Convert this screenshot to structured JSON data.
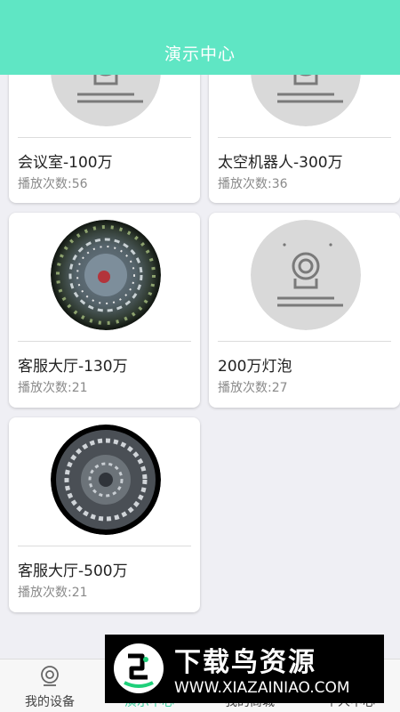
{
  "header": {
    "title": "演示中心"
  },
  "cards": [
    {
      "name": "会议室-100万",
      "plays": "播放次数:56",
      "thumb": "camera-placeholder"
    },
    {
      "name": "太空机器人-300万",
      "plays": "播放次数:36",
      "thumb": "camera-placeholder"
    },
    {
      "name": "客服大厅-130万",
      "plays": "播放次数:21",
      "thumb": "fisheye-photo"
    },
    {
      "name": "200万灯泡",
      "plays": "播放次数:27",
      "thumb": "camera-placeholder"
    },
    {
      "name": "客服大厅-500万",
      "plays": "播放次数:21",
      "thumb": "fisheye-photo"
    }
  ],
  "tabbar": {
    "tabs": [
      {
        "label": "我的设备",
        "icon": "camera-icon"
      },
      {
        "label": "演示中心",
        "icon": "play-icon",
        "active": true
      },
      {
        "label": "我的商城",
        "icon": "store-icon"
      },
      {
        "label": "个人中心",
        "icon": "person-icon"
      }
    ]
  },
  "watermark": {
    "title": "下载鸟资源",
    "url": "WWW.XIAZAINIAO.COM"
  },
  "colors": {
    "header": "#5fe6c4",
    "active_tab": "#3ccf9f"
  }
}
